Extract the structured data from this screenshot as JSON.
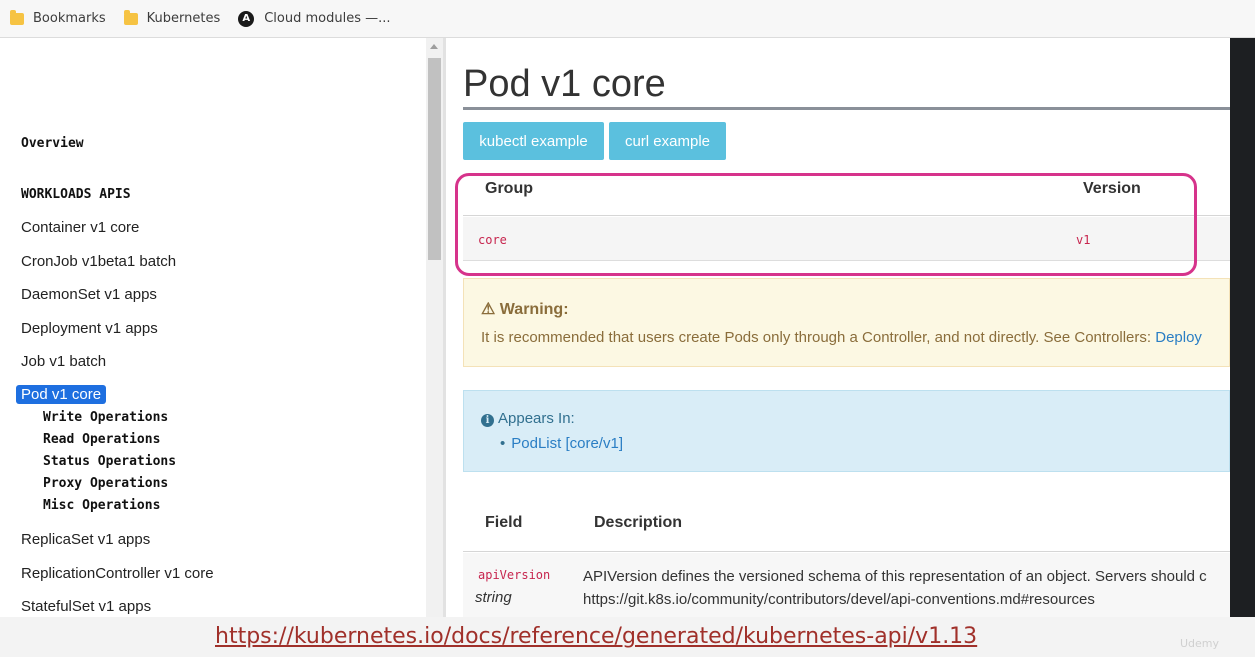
{
  "bookmarks": [
    {
      "label": "Bookmarks",
      "icon": "folder-icon"
    },
    {
      "label": "Kubernetes",
      "icon": "folder-icon"
    },
    {
      "label": "Cloud modules —...",
      "icon": "ansible-icon",
      "icon_glyph": "A"
    }
  ],
  "sidebar": {
    "overview": "Overview",
    "section_heading": "WORKLOADS APIS",
    "items": [
      "Container v1 core",
      "CronJob v1beta1 batch",
      "DaemonSet v1 apps",
      "Deployment v1 apps",
      "Job v1 batch",
      "Pod v1 core",
      "ReplicaSet v1 apps",
      "ReplicationController v1 core",
      "StatefulSet v1 apps"
    ],
    "active_item": "Pod v1 core",
    "sub_items": [
      "Write Operations",
      "Read Operations",
      "Status Operations",
      "Proxy Operations",
      "Misc Operations"
    ]
  },
  "main": {
    "title": "Pod v1 core",
    "buttons": {
      "kubectl": "kubectl example",
      "curl": "curl example"
    },
    "group_table": {
      "headers": {
        "group": "Group",
        "version": "Version"
      },
      "row": {
        "group": "core",
        "version": "v1"
      }
    },
    "warning": {
      "icon": "⚠",
      "title": "Warning:",
      "text": "It is recommended that users create Pods only through a Controller, and not directly. See Controllers: ",
      "link": "Deploy"
    },
    "appears_in": {
      "icon_glyph": "i",
      "title": "Appears In:",
      "links": [
        "PodList [core/v1]"
      ]
    },
    "fields_table": {
      "headers": {
        "field": "Field",
        "description": "Description"
      },
      "rows": [
        {
          "name": "apiVersion",
          "type": "string",
          "description_line1": "APIVersion defines the versioned schema of this representation of an object. Servers should c",
          "description_line2": "https://git.k8s.io/community/contributors/devel/api-conventions.md#resources"
        }
      ]
    }
  },
  "overlay": {
    "url": "https://kubernetes.io/docs/reference/generated/kubernetes-api/v1.13",
    "watermark": "Udemy"
  },
  "colors": {
    "button": "#5bc0de",
    "active_nav": "#1e6fe0",
    "highlight_box": "#d6338b",
    "code_red": "#c7254e"
  }
}
